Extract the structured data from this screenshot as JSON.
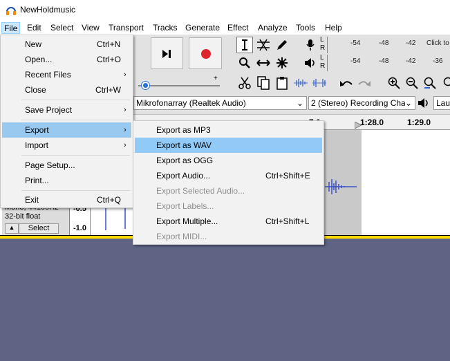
{
  "window": {
    "title": "NewHoldmusic"
  },
  "menubar": [
    "File",
    "Edit",
    "Select",
    "View",
    "Transport",
    "Tracks",
    "Generate",
    "Effect",
    "Analyze",
    "Tools",
    "Help"
  ],
  "meters": {
    "record_scale": [
      "-54",
      "-48",
      "-42"
    ],
    "record_hint": "Click to",
    "playback_scale": [
      "-54",
      "-48",
      "-42",
      "-36"
    ],
    "L": "L",
    "R": "R"
  },
  "device": {
    "input": "Mikrofonarray (Realtek Audio)",
    "channels": "2 (Stereo) Recording Chai",
    "output": "Laut"
  },
  "timeline": {
    "labels": [
      "1:28.0",
      "1:29.0"
    ],
    "partial": "7.0"
  },
  "track": {
    "info1": "Mono, 44100Hz",
    "info2": "32-bit float",
    "select_label": "Select",
    "scale_mid": "-0.5",
    "scale_bottom": "-1.0"
  },
  "file_menu": {
    "items": [
      {
        "label": "New",
        "shortcut": "Ctrl+N"
      },
      {
        "label": "Open...",
        "shortcut": "Ctrl+O"
      },
      {
        "label": "Recent Files",
        "submenu": true
      },
      {
        "label": "Close",
        "shortcut": "Ctrl+W"
      },
      {
        "label": "Save Project",
        "submenu": true
      },
      {
        "label": "Export",
        "submenu": true
      },
      {
        "label": "Import",
        "submenu": true
      },
      {
        "label": "Page Setup..."
      },
      {
        "label": "Print..."
      },
      {
        "label": "Exit",
        "shortcut": "Ctrl+Q"
      }
    ]
  },
  "export_menu": {
    "items": [
      {
        "label": "Export as MP3"
      },
      {
        "label": "Export as WAV"
      },
      {
        "label": "Export as OGG"
      },
      {
        "label": "Export Audio...",
        "shortcut": "Ctrl+Shift+E"
      },
      {
        "label": "Export Selected Audio...",
        "disabled": true
      },
      {
        "label": "Export Labels...",
        "disabled": true
      },
      {
        "label": "Export Multiple...",
        "shortcut": "Ctrl+Shift+L"
      },
      {
        "label": "Export MIDI...",
        "disabled": true
      }
    ]
  },
  "colors": {
    "highlight": "#99c9ef",
    "background": "#5f6485",
    "waveform": "#3a4fc8",
    "record": "#e0242b"
  }
}
